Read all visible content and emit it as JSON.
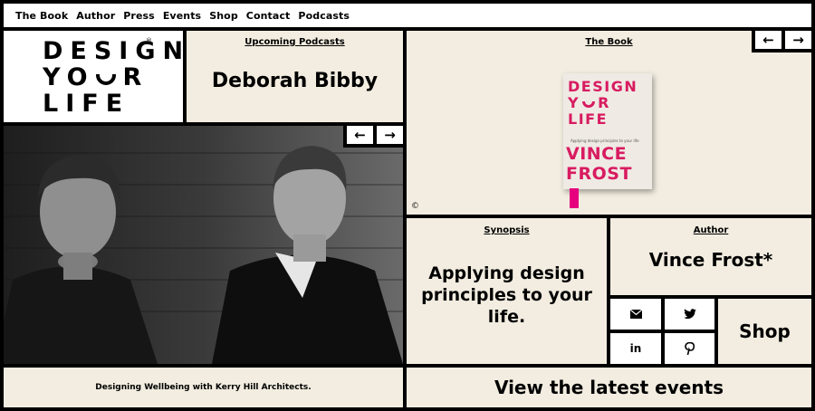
{
  "nav": {
    "items": [
      "The Book",
      "Author",
      "Press",
      "Events",
      "Shop",
      "Contact",
      "Podcasts"
    ]
  },
  "logo": {
    "line1": "DESIGN",
    "line2_left": "YO",
    "line2_right": "R",
    "line3": "LIFE",
    "mark": "®"
  },
  "podcasts": {
    "label": "Upcoming Podcasts",
    "name": "Deborah Bibby"
  },
  "book": {
    "label": "The Book",
    "copyright": "©",
    "cover": {
      "line1": "DESIGN",
      "line2_left": "Y",
      "line2_right": "R",
      "line3": "LIFE",
      "subtitle": "Applying design principles to your life",
      "author1": "VINCE",
      "author2": "FROST"
    }
  },
  "arrows": {
    "prev": "←",
    "next": "→"
  },
  "synopsis": {
    "label": "Synopsis",
    "text": "Applying design principles to your life."
  },
  "author": {
    "label": "Author",
    "name": "Vince Frost*"
  },
  "social": {
    "mail": "✉",
    "twitter": "t",
    "linkedin": "in",
    "pinterest": "P"
  },
  "shop": {
    "label": "Shop"
  },
  "caption": {
    "text": "Designing Wellbeing with Kerry Hill Architects."
  },
  "events": {
    "label": "View the latest events"
  },
  "colors": {
    "background": "#000000",
    "panel": "#f2ede0",
    "white": "#ffffff",
    "accent": "#d81b60"
  },
  "icons": {
    "mail": "mail-icon",
    "twitter": "twitter-icon",
    "linkedin": "linkedin-icon",
    "pinterest": "pinterest-icon",
    "prev": "arrow-left-icon",
    "next": "arrow-right-icon"
  }
}
